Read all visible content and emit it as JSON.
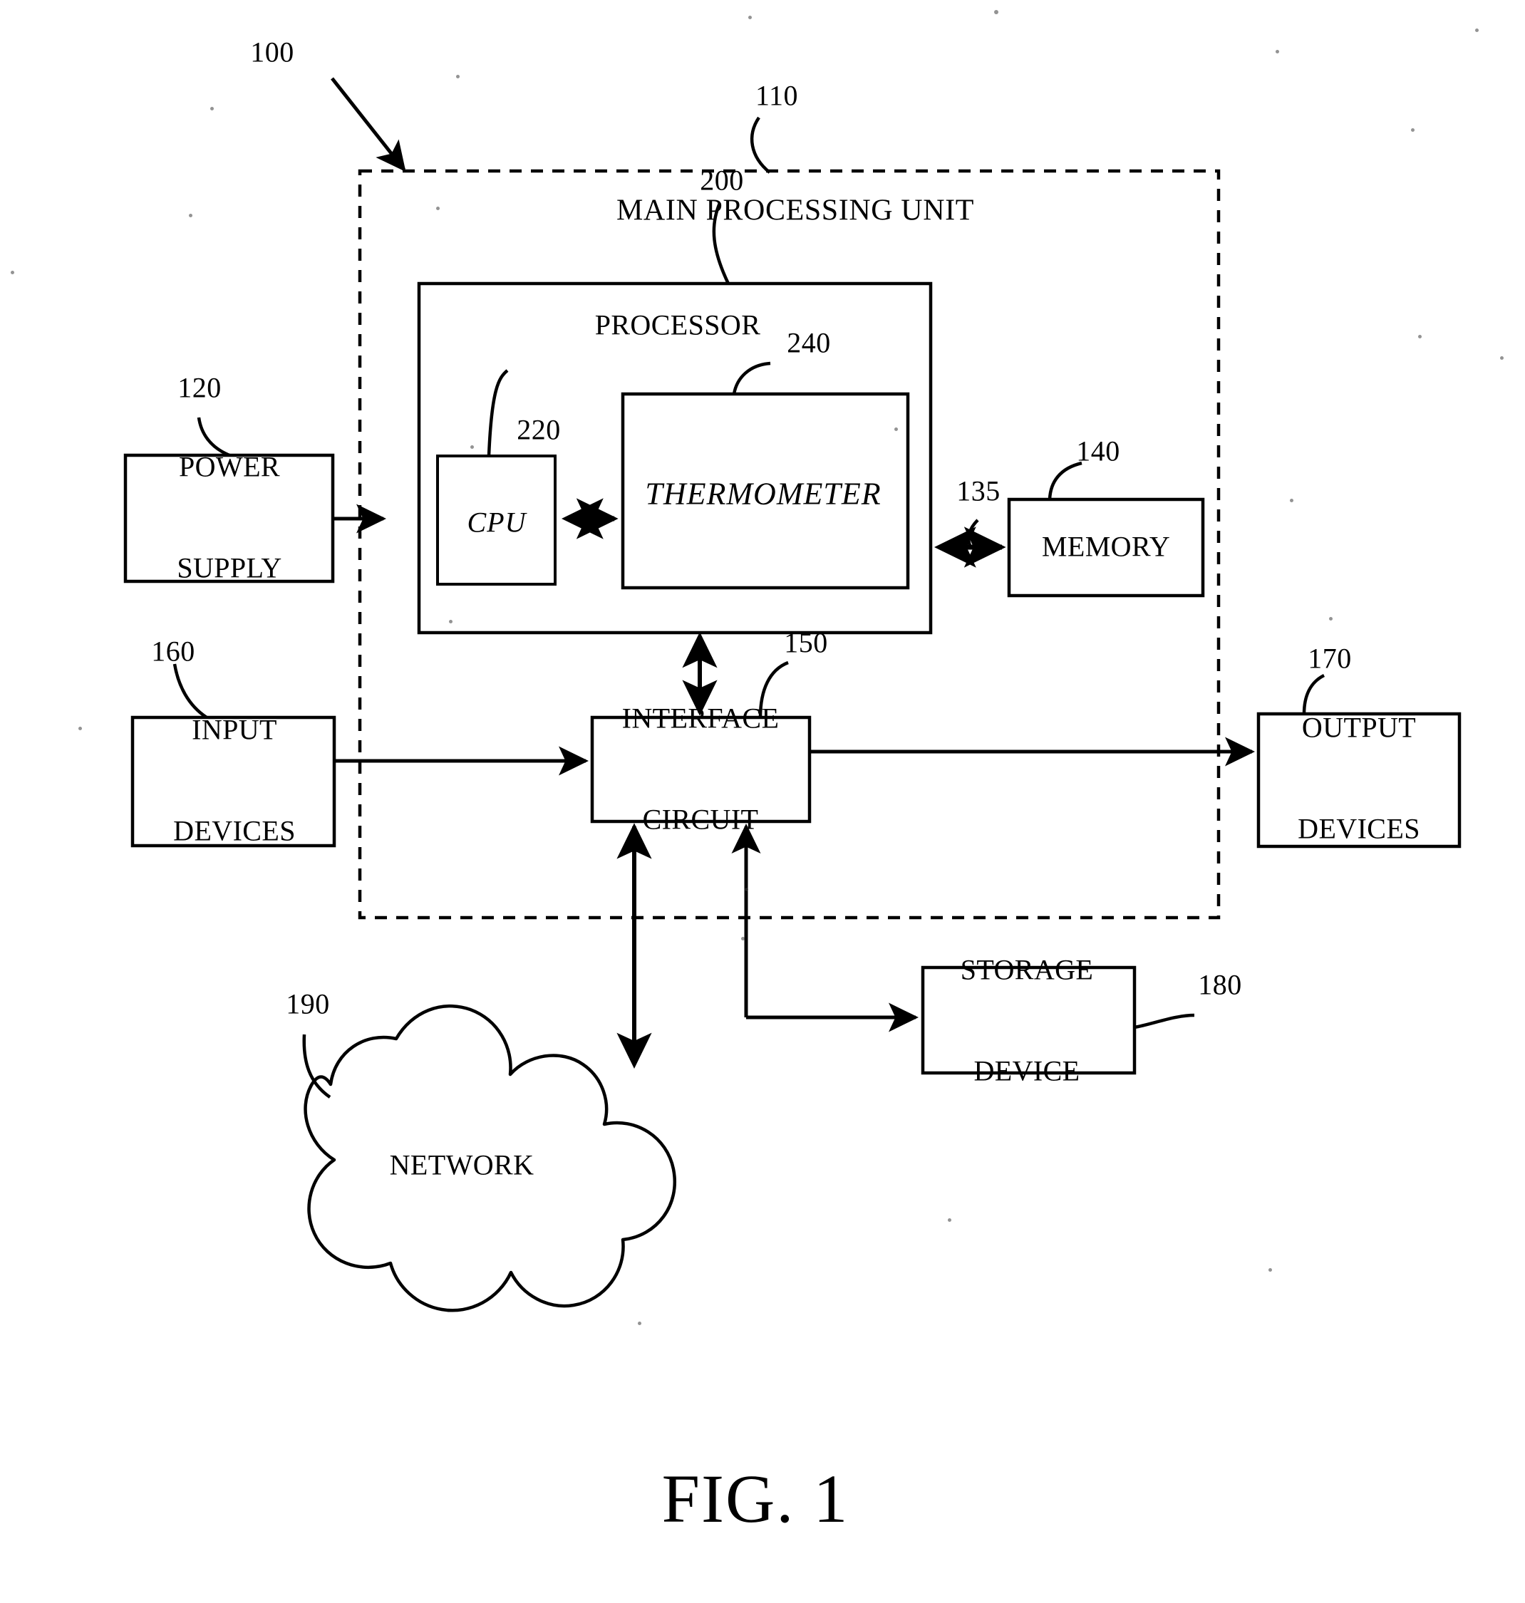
{
  "figure": {
    "caption": "FIG. 1",
    "system_ref": "100"
  },
  "main_unit": {
    "title": "MAIN PROCESSING UNIT",
    "ref": "110"
  },
  "processor": {
    "title": "PROCESSOR",
    "ref": "200",
    "cpu": {
      "label": "CPU",
      "ref": "220"
    },
    "thermometer": {
      "label": "THERMOMETER",
      "ref": "240"
    }
  },
  "blocks": {
    "power_supply": {
      "line1": "POWER",
      "line2": "SUPPLY",
      "ref": "120"
    },
    "memory": {
      "label": "MEMORY",
      "ref": "140"
    },
    "input_devices": {
      "line1": "INPUT",
      "line2": "DEVICES",
      "ref": "160"
    },
    "output_devices": {
      "line1": "OUTPUT",
      "line2": "DEVICES",
      "ref": "170"
    },
    "interface_circuit": {
      "line1": "INTERFACE",
      "line2": "CIRCUIT",
      "ref": "150"
    },
    "storage_device": {
      "line1": "STORAGE",
      "line2": "DEVICE",
      "ref": "180"
    },
    "network": {
      "label": "NETWORK",
      "ref": "190"
    }
  },
  "connections": {
    "processor_memory_bus_ref": "135"
  },
  "colors": {
    "ink": "#000000",
    "paper": "#ffffff"
  }
}
